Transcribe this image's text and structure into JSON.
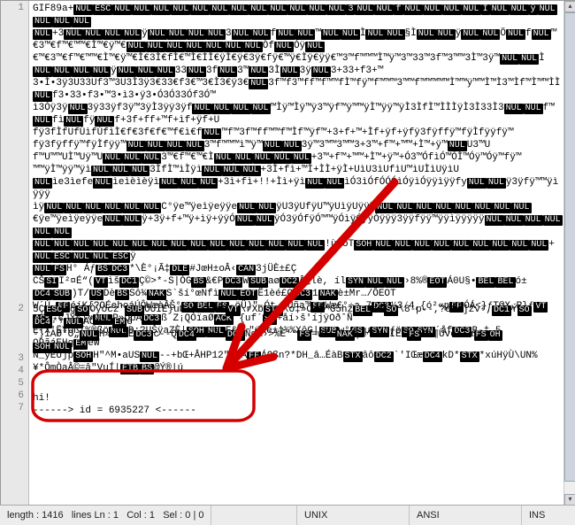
{
  "line_numbers": [
    1,
    2,
    3,
    4,
    5,
    6,
    7
  ],
  "binary_block_1": {
    "prefix": "GIF89a+",
    "tokens": [
      "NUL",
      "ESC",
      "NUL",
      "NUL",
      "NUL",
      "NUL",
      "NUL",
      "NUL",
      "NUL",
      "NUL",
      "NUL",
      "NUL",
      "NUL",
      "NUL",
      "3",
      "NUL",
      "NUL",
      "f",
      "NUL",
      "NUL",
      "NUL",
      "NUL",
      "Ì",
      "NUL",
      "NUL",
      "ÿ",
      "NUL",
      "NUL",
      "NUL",
      "NUL"
    ],
    "mid": "3",
    "tokens2": [
      "NUL",
      "NUL",
      "NUL",
      "NUL",
      "NUL",
      "NUL",
      "NUL",
      "NUL",
      "NUL",
      "NUL",
      "NUL",
      "NUL",
      "NUL"
    ],
    "trail": "f3f3™f3Ìf3ÿf"
  },
  "binary_filler": "€™€3™€f™€™™€Ì™€ÿ™€Ì€3Ì€fÌ€™Ì€ÌÌ€ÿÌ€ÿ€3ÿ€fÿ€™ÿ€Ìÿ€ÿÿ€™3™f™™™Ì™ÿ™3™33™3f™3™™3Ì™3ÿ™3f™f3™ff™f™™fÌ™fÿ™f™™™3™™f™™™™™Ì™™ÿ™™Ì™Ì3™Ìf™Ì™™ÌÌ™Ìÿ™Ìÿ™ÿ3™ÿf™ÿ™™ÿÌ™ÿÿ™ÿÌ3ÌfÌ™ÌÌÌÿÌ3Ì33Ì3fÌ3™Ì3ÌÌ3ÿÌ3fÌf3ÌffÌf™ÌfÌÌfÿÌf™Ì™3Ì™fÌ™™Ì™ÌÌ™ÿÌ™ÌÌÌ3ÌÌfÌÌ™ÌÌÌÌÌÿÌÌÿÌÿ3ÌÿfÌÿ™ÌÿÌÌÿÿÌÿÿ3ÿfÿ™ÿÌÿÿÿ3ÿ33ÿ3fÿ3™ÿ3Ìÿ3ÿÿ3fÿf3ÿffÿf™ÿfÌÿfÿÿf™ÿ™3ÿ™fÿ™™ÿ™Ìÿ™ÿÿ™Ìÿ",
  "binary_tokens_row2": [
    "NUL",
    "NUL",
    "NUL",
    "NUL"
  ],
  "filler_row3": "™€3™€f™€™™€Ì™€ÿ™€",
  "binary_tokens_row3": [
    "NUL",
    "NUL",
    "NUL",
    "NUL",
    "NUL",
    "NUL",
    "NUL"
  ],
  "filler_row4": "3•Ì•3ÿ3U33Uf3™3U3Ì3ÿ3€33€f3€™3€Ì3€ÿ3€",
  "binary_tokens_row4": [
    "NUL"
  ],
  "filler_row5": "ì3Óÿ3ÿ",
  "binary_tokens_row5": [
    "NUL"
  ],
  "filler_row5b": "3ÿ33ÿf3ÿ™3ÿÌ3ÿÿ3ÿf",
  "binary_tokens_row5b": [
    "NUL",
    "NUL",
    "NUL",
    "NUL"
  ],
  "filler_row6": "fÿ3fÌfUfÙìfÙfìÌ€f€3f€f€™f€ì€f",
  "binary_tokens_row6": [
    "NUL"
  ],
  "filler_row6b": "™f™3f™ff™™f™Ìf™ÿf™+3+f+™+Ìf+ÿf+ÿfÿ3fÿffÿ™fÿÌfÿÿfÿ™",
  "filler_row7": "fÿ3fÿffÿ™fÿÌfÿÿ™",
  "binary_tokens_row7": [
    "NUL",
    "NUL",
    "NUL",
    "NUL"
  ],
  "filler_row7b": "3™f™™™ì™ÿ™",
  "binary_tokens_row7b": [
    "NUL",
    "NUL"
  ],
  "filler_row7c": "3ÿ™3™™3™™3+3™+f™+™™+Ì™+ÿ™",
  "binary_tokens_row7c": [
    "NUL"
  ],
  "filler_row7d": "U3™U",
  "filler_row8": "f™U™™UÌ™Uÿ™U",
  "binary_tokens_row8": [
    "NUL",
    "NUL",
    "NUL"
  ],
  "filler_row8b": "3™€f™€™€Ì",
  "binary_tokens_row8b": [
    "NUL",
    "NUL",
    "NUL",
    "NUL",
    "NUL"
  ],
  "filler_row8c": "+3™+f™+™™+Ì™+ÿ™+Ó3™ÓfìÓ™ÓÌ™Óÿ™Óÿ™fÿ™",
  "filler_row9": "™™ÿÌ™ÿÿ™ÿì",
  "binary_tokens_row9": [
    "NUL",
    "NUL",
    "NUL"
  ],
  "filler_row9b": "3ÌfÌ™ìÌÿì",
  "binary_tokens_row9b": [
    "NUL",
    "NUL",
    "NUL"
  ],
  "filler_row9c": "+3Ì+fì+™Ì+ÌÌ+ÿÌ+UìU3ìUfìU™ìUÌìUÿìU",
  "filler_row10": "",
  "binary_tokens_row10": [
    "NUL"
  ],
  "filler_row10b": "ìe3ìefe",
  "binary_tokens_row10b": [
    "NUL"
  ],
  "filler_row10c": "ìeìèìèÿì",
  "binary_tokens_row10c": [
    "NUL",
    "NUL",
    "NUL"
  ],
  "filler_row10d": "+3ì+fì+!!+Ìì+ÿì",
  "binary_tokens_row10d": [
    "NUL",
    "NUL"
  ],
  "filler_row10e": "ìÓ3ìÓfÓÓÓìÓÿìÓÿÿìÿÿfy",
  "binary_tokens_row10e": [
    "NUL",
    "NUL"
  ],
  "filler_row10f": "ÿ3ÿfÿ™™ÿìÿÿÿ",
  "filler_row11": "ìÿ",
  "binary_tokens_row11": [
    "NUL",
    "NUL",
    "NUL",
    "NUL",
    "NUL",
    "NUL"
  ],
  "filler_row11b": "C°ÿe™ÿeìÿeÿÿe",
  "binary_tokens_row11b": [
    "NUL",
    "NUL"
  ],
  "filler_row11c": "ÿU3ÿUfÿU™ÿUìÿUÿÿU",
  "binary_tokens_row11c": [
    "NUL",
    "NUL",
    "NUL",
    "NUL",
    "NUL",
    "NUL",
    "NUL",
    "NUL"
  ],
  "filler_row12": "€ÿe™ÿeìÿeÿÿe",
  "binary_tokens_row12": [
    "NUL",
    "NUL"
  ],
  "filler_row12b": "ÿ+3ÿ+f+™ÿ+ìÿ+ÿÿÓ",
  "binary_tokens_row12b": [
    "NUL",
    "NUL"
  ],
  "filler_row12c": "ÿÓ3ÿÓfÿÓ™™ÿÓìÿÓÿÿÓÿÿÿ3ÿÿfÿÿ™ÿÿìÿÿÿÿÿ",
  "binary_tokens_row12c": [
    "NUL",
    "NUL",
    "NUL",
    "NUL",
    "NUL",
    "NUL"
  ],
  "filler_row13": "",
  "binary_tokens_row13": [
    "NUL",
    "NUL",
    "NUL",
    "NUL",
    "NUL",
    "NUL",
    "NUL",
    "NUL",
    "NUL",
    "NUL",
    "NUL",
    "NUL",
    "NUL",
    "NUL",
    "NUL"
  ],
  "filler_row13b": "!ùeoT",
  "binary_tokens_row13b": [
    "SOH",
    "NUL",
    "NUL",
    "NUL",
    "NUL",
    "NUL",
    "NUL",
    "NUL",
    "NUL",
    "NUL"
  ],
  "filler_row13c": "+",
  "binary_tokens_row13c": [
    "NUL",
    "ESC",
    "NUL",
    "NUL",
    "ESC"
  ],
  "filler_row13d": "ÿ",
  "filler_row14": "",
  "binary_tokens_row14": [
    "NUL",
    "FS"
  ],
  "filler_row14b": "H° Áƒ",
  "binary_tokens_row14b": [
    "BS",
    "DC3"
  ],
  "filler_row14c": "*\\È°¡Ã‡",
  "binary_tokens_row14c": [
    "DLE"
  ],
  "filler_row14d": "#JœH±oÂ‹",
  "binary_tokens_row14d": [
    "CAN"
  ],
  "filler_row14e": "3jÜÈ±£Ç",
  "filler_row15": "CŠ",
  "binary_tokens_row15": [
    "SI"
  ],
  "filler_row15b": "I²¤É“(",
  "binary_tokens_row15b": [
    "VT"
  ],
  "filler_row15c": "ìš",
  "binary_tokens_row15c": [
    "DC1"
  ],
  "filler_row15d": "Ç©>*-S|ÓG",
  "binary_tokens_row15d": [
    "BS"
  ],
  "filler_row15e": "&€P",
  "binary_tokens_row15e": [
    "DC3"
  ],
  "filler_row15f": "W",
  "binary_tokens_row15f": [
    "SUB"
  ],
  "filler_row15g": "aø",
  "binary_tokens_row15g": [
    "DC2"
  ],
  "filler_row15h": "Â¿lè, íl",
  "binary_tokens_row15h": [
    "SYN",
    "NUL",
    "NUL"
  ],
  "filler_row15i": "›8%®",
  "binary_tokens_row15i": [
    "EOT"
  ],
  "filler_row15j": "Á0U§•",
  "binary_tokens_row15j": [
    "BEL",
    "BEL"
  ],
  "filler_row15k": "ó±",
  "filler_row16": "",
  "binary_tokens_row16": [
    "DC4",
    "SUB"
  ],
  "filler_row16b": ")T/",
  "binary_tokens_row16b": [
    "US"
  ],
  "filler_row16c": "Dè",
  "binary_tokens_row16c": [
    "BS"
  ],
  "filler_row16d": "Sô¾",
  "binary_tokens_row16d": [
    "NAK"
  ],
  "filler_row16e": "S`ší°œNfì",
  "binary_tokens_row16e": [
    "NUL",
    "EOT"
  ],
  "filler_row16f": "Ë1èé£G",
  "binary_tokens_row16f": [
    "DC3"
  ],
  "filler_row16g": "1",
  "binary_tokens_row16g": [
    "NAK"
  ],
  "filler_row16h": "è±Mr…/ÔEOT",
  "filler_row17": "W´Ú,",
  "binary_tokens_row17": [
    "FF"
  ],
  "filler_row17b": "éíK{?OÉehoáÚÔWæàÂŠ°",
  "binary_tokens_row17b": [
    "SO",
    "BEL",
    "FS"
  ],
  "filler_row17c": "-öÜ)\"-Ót, Üña™",
  "binary_tokens_row17c": [
    "FF"
  ],
  "filler_row17d": "Wæ€°÷a,7",
  "binary_tokens_row17d": [
    "DC3"
  ],
  "filler_row17e": "¼3⁄4,{ó²«p",
  "binary_tokens_row17e": [
    "FF"
  ],
  "filler_row17f": "ÓÁ<}ƒT@X„R}ƒ",
  "binary_tokens_row17f": [
    "VT"
  ],
  "filler_row18": "",
  "binary_tokens_row18": [
    "ACK"
  ],
  "filler_row18b": "¸çJÝ¾}«",
  "binary_tokens_row18b": [
    "NUL"
  ],
  "filler_row18c": "P»ÖpÁ",
  "binary_tokens_row18c": [
    "DC3"
  ],
  "filler_row18d": "ß      Z¡QÓïaØ",
  "binary_tokens_row18d": [
    "ACK"
  ],
  "filler_row18e": "`{uf´",
  "binary_tokens_row18e": [
    "SI"
  ],
  "filler_row18f": "+åí›š'íjÿOðˆÑ",
  "filler_row19": "ETX'ËÝÔß{%®ßö",
  "binary_tokens_row19": [
    "NUL"
  ],
  "filler_row19b": "D;?UŠÿaZÈ|",
  "binary_tokens_row19b": [
    "SOH",
    "NUL"
  ],
  "filler_row19c": "F&°-\"ÿüe±‡¾%XôG|",
  "binary_tokens_row19c": [
    "SUB"
  ],
  "filler_row19d": "w°",
  "binary_tokens_row19d": [
    "GS"
  ],
  "filler_row19e": "µ",
  "binary_tokens_row19e": [
    "SYN"
  ],
  "filler_row19f": "ƒö",
  "binary_tokens_row19f": [
    "SO",
    "SYN"
  ],
  "filler_row19g": "´åf",
  "binary_tokens_row19g": [
    "DC3"
  ],
  "filler_row19h": "B-‡  5",
  "filler_row20": "O9ãáEHg",
  "binary_tokens_row20": [
    "EM"
  ],
  "filler_row20b": "èW",
  "filler_row21": "N_ÿÈÙjp",
  "binary_tokens_row21": [
    "SOH"
  ],
  "filler_row21b": "H\"^M•aUS",
  "binary_tokens_row21b": [
    "NUL"
  ],
  "filler_row21c": "--+bŒ+ÂHP12\"Ý\\Á",
  "binary_tokens_row21c": [
    "FF"
  ],
  "filler_row21d": "ÁQßn?*DH_â…ÉàB",
  "binary_tokens_row21d": [
    "STX"
  ],
  "filler_row21e": "âô",
  "binary_tokens_row21e": [
    "DC2"
  ],
  "filler_row21f": "`'IŒæ",
  "binary_tokens_row21f": [
    "DC4"
  ],
  "filler_row21g": "kD*",
  "binary_tokens_row21g": [
    "STX"
  ],
  "filler_row21h": "*xúHÿÙ\\UN%",
  "filler_row22": "¥*ÔmÒaÂ©=â\"VuÍ|",
  "binary_tokens_row22": [
    "ETB",
    "BS"
  ],
  "filler_row22b": "@Ý®|ú",
  "lineblk2": {
    "prefix": "5Ç",
    "tokens": [
      "ESC"
    ],
    "s1": "kg",
    "t2": [
      "SO"
    ],
    "s2": "Òÿöczˆ",
    "t3": [
      "SUB"
    ],
    "s3": "ÔUÌE}uÞ¹m´Ö9Xœ",
    "t4": [
      "VT"
    ],
    "s4": "\\rXb",
    "t5": [
      "STX"
    ],
    "s5": "\\o‡»ÖXÒ^G5hž",
    "t6": [
      "BEL"
    ],
    "s6": "iX",
    "t7": [
      "SO"
    ],
    "s7": "\\8-p--,?èÒè]žv²,",
    "t8": [
      "DC1"
    ],
    "s8": "Ý",
    "t9": [
      "SO"
    ]
  },
  "lineblk2_row2": {
    "t1": [
      "DC4"
    ],
    "s1": "**",
    "t2": [
      "NUL"
    ],
    "s2": "AÒéAÒ",
    "t3": [
      "EM"
    ],
    "s3": "é"
  },
  "lineblk2_row3": {
    "s0": "-}íAØ*O„",
    "t1": [
      "NUL"
    ],
    "s1": "H»ïìtÊ",
    "t2": [
      "DC3"
    ],
    "s2": "c--Q",
    "t3": [
      "DC4"
    ],
    "s3": "-À≥š-",
    "t4": [
      "DC3"
    ],
    "s4": "ÑdA›>%È´°",
    "t5": [
      "FS"
    ],
    "s5": "=w\"£",
    "t6": [
      "NAK"
    ],
    "s6": "Çí^Ù=»IÉŠ",
    "t7": [
      "FS"
    ],
    "s7": "Kí¶Üvëí·à",
    "t8": [
      "FS",
      "OH"
    ]
  },
  "lineblk2_row4": {
    "t1": [
      "SOH",
      "NUL"
    ],
    "s1": ";"
  },
  "messages": {
    "line6": "hi!",
    "line7": "------> id = 6935227 <------"
  },
  "status": {
    "length_label": "length :",
    "length_value": "1416",
    "lines_label": "lines",
    "lines_value": "Ln : 1",
    "col_label": "Col :",
    "col_value": "1",
    "sel_label": "Sel :",
    "sel_value": "0 | 0",
    "eol": "UNIX",
    "encoding": "ANSI",
    "mode": "INS"
  }
}
